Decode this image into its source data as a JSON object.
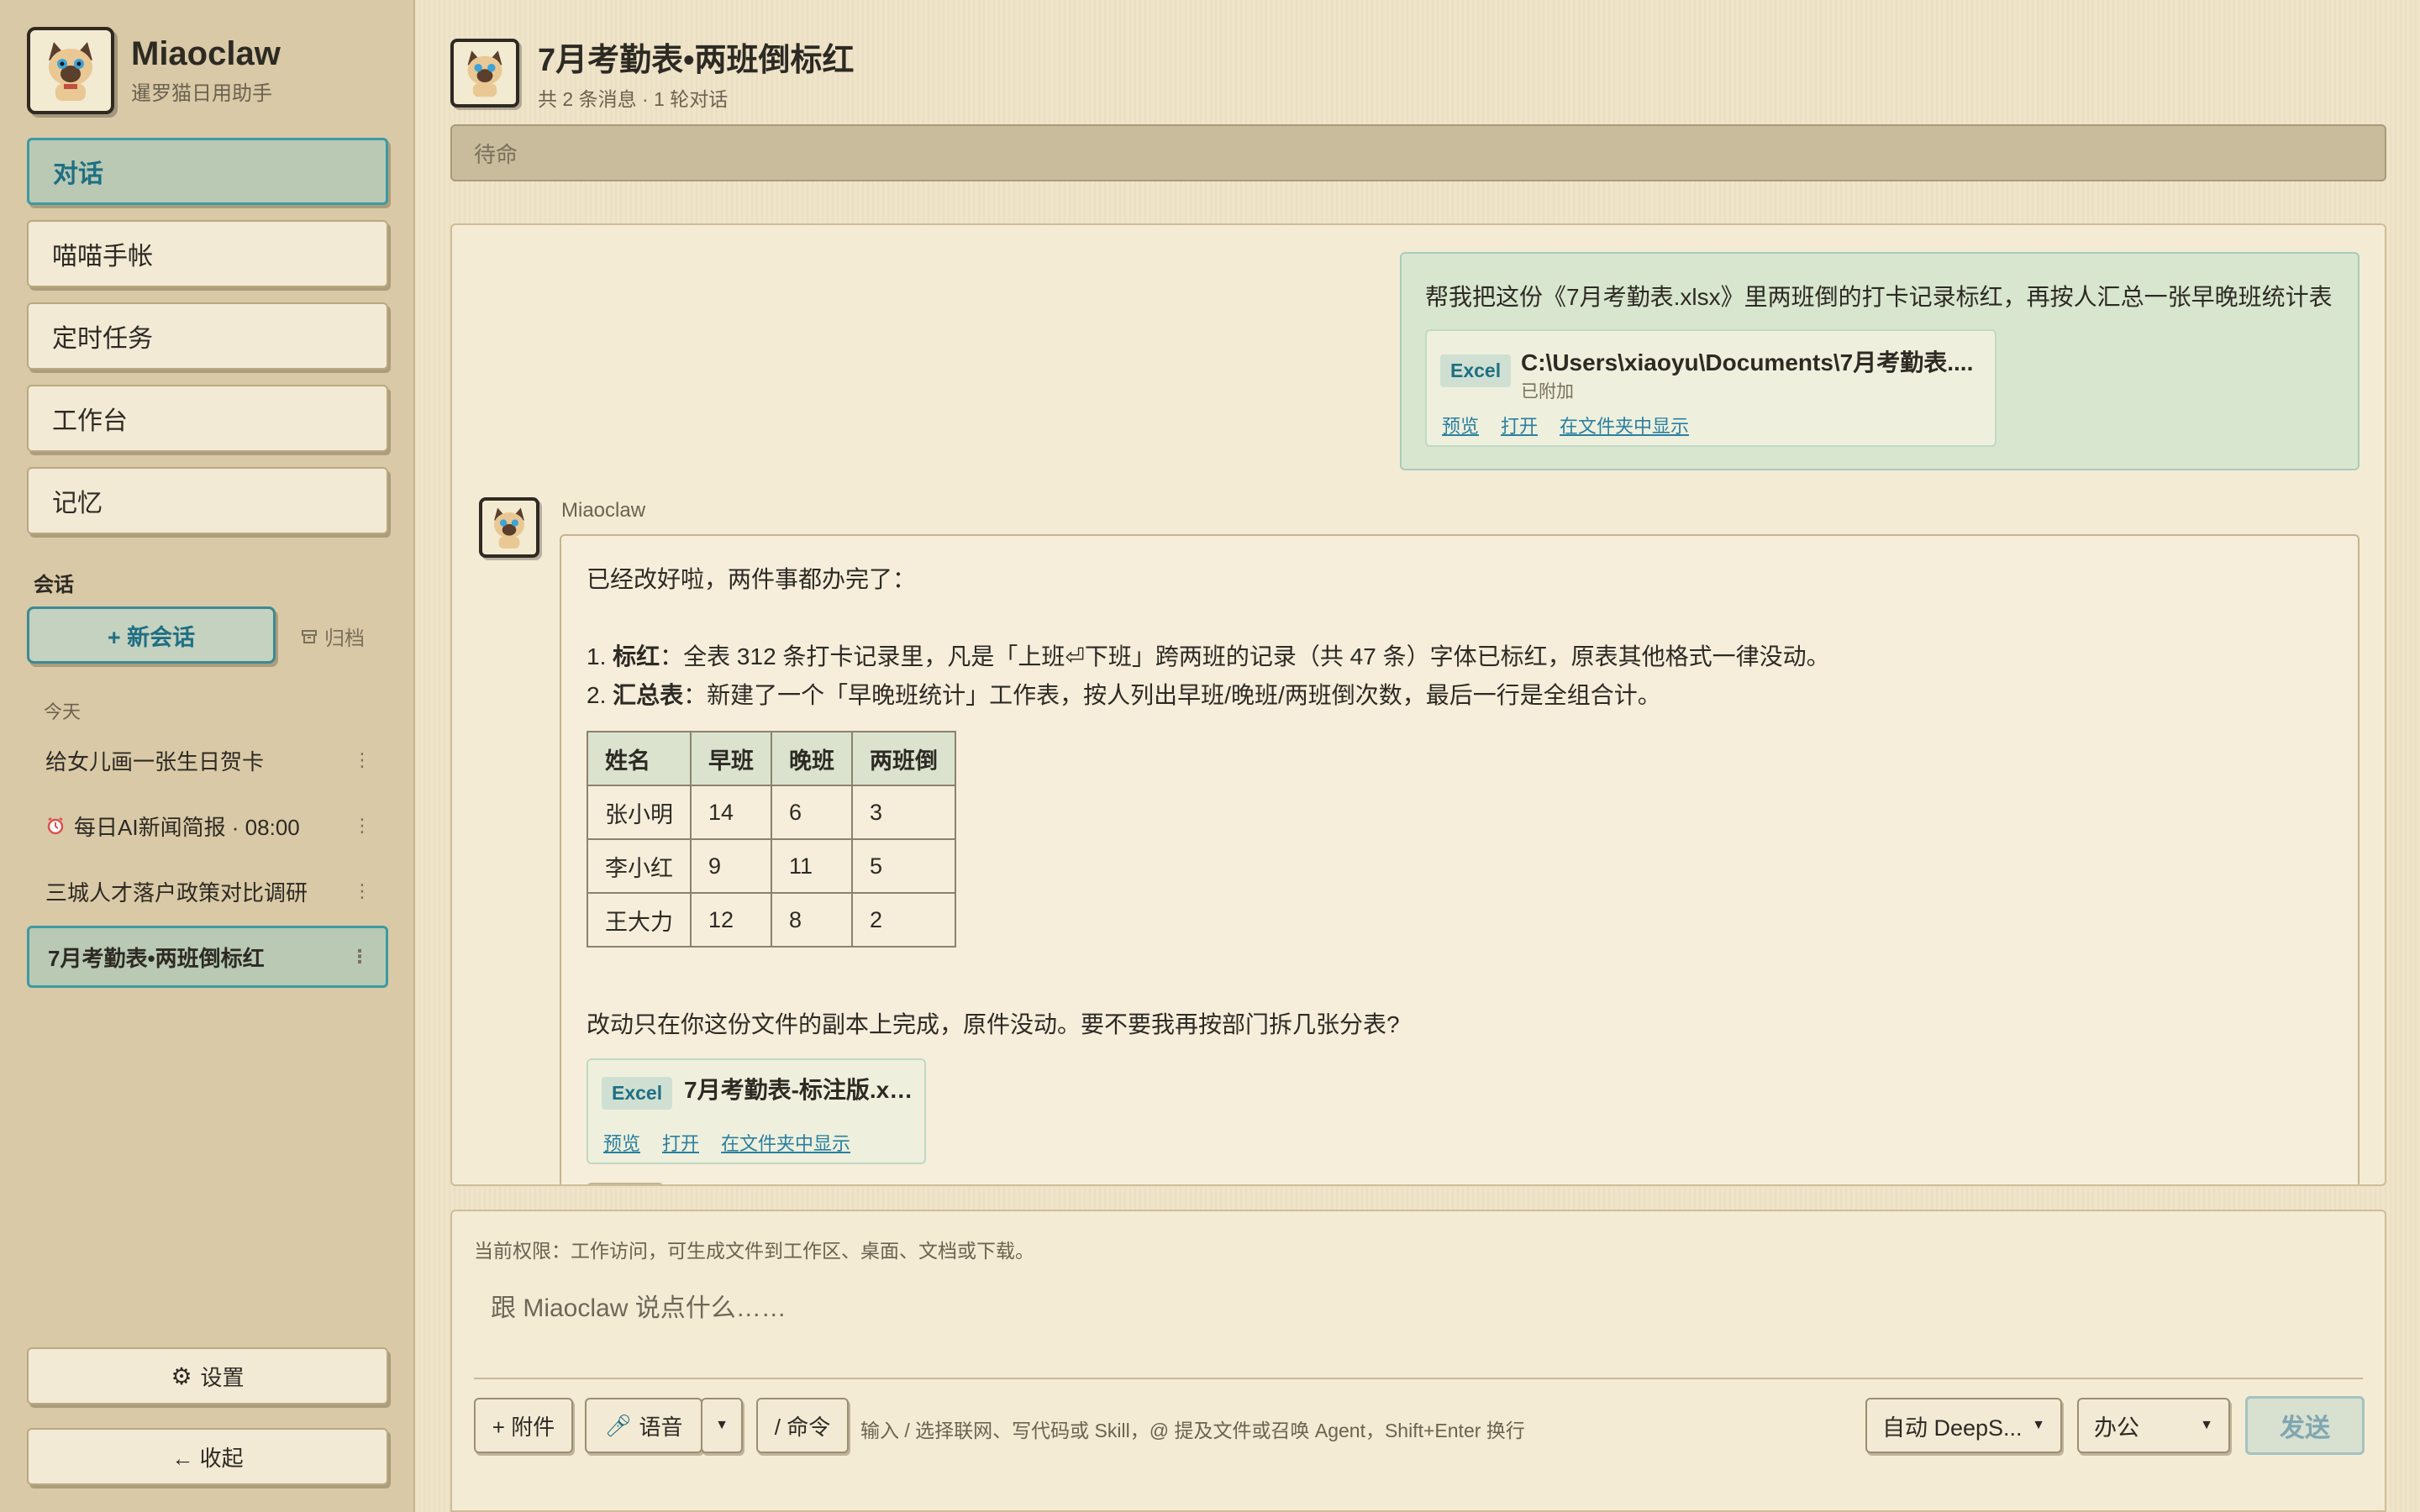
{
  "brand": {
    "title": "Miaoclaw",
    "subtitle": "暹罗猫日用助手"
  },
  "nav": [
    {
      "label": "对话",
      "active": true
    },
    {
      "label": "喵喵手帐"
    },
    {
      "label": "定时任务"
    },
    {
      "label": "工作台"
    },
    {
      "label": "记忆"
    }
  ],
  "sessions_section": {
    "label": "会话",
    "new_chat": "+ 新会话",
    "archive": "归档",
    "today": "今天",
    "items": [
      {
        "label": "给女儿画一张生日贺卡"
      },
      {
        "label": "每日AI新闻简报 · 08:00",
        "icon": "alarm-clock-icon"
      },
      {
        "label": "三城人才落户政策对比调研"
      },
      {
        "label": "7月考勤表•两班倒标红",
        "active": true
      }
    ]
  },
  "sidebar_footer": {
    "settings": "设置",
    "collapse": "← 收起"
  },
  "header": {
    "title": "7月考勤表•两班倒标红",
    "subtitle": "共 2 条消息 · 1 轮对话"
  },
  "status": "待命",
  "user_message": {
    "text": "帮我把这份《7月考勤表.xlsx》里两班倒的打卡记录标红，再按人汇总一张早晚班统计表",
    "file": {
      "badge": "Excel",
      "name": "C:\\Users\\xiaoyu\\Documents\\7月考勤表....",
      "status": "已附加",
      "links": [
        "预览",
        "打开",
        "在文件夹中显示"
      ]
    }
  },
  "bot_message": {
    "name": "Miaoclaw",
    "intro": "已经改好啦，两件事都办完了：",
    "point1_label": "标红",
    "point1_text": "：全表 312 条打卡记录里，凡是「上班⏎下班」跨两班的记录（共 47 条）字体已标红，原表其他格式一律没动。",
    "point2_label": "汇总表",
    "point2_text": "：新建了一个「早晚班统计」工作表，按人列出早班/晚班/两班倒次数，最后一行是全组合计。",
    "table": {
      "headers": [
        "姓名",
        "早班",
        "晚班",
        "两班倒"
      ],
      "rows": [
        [
          "张小明",
          "14",
          "6",
          "3"
        ],
        [
          "李小红",
          "9",
          "11",
          "5"
        ],
        [
          "王大力",
          "12",
          "8",
          "2"
        ]
      ]
    },
    "outro": "改动只在你这份文件的副本上完成，原件没动。要不要我再按部门拆几张分表?",
    "file": {
      "badge": "Excel",
      "name": "7月考勤表-标注版.xlsx",
      "links": [
        "预览",
        "打开",
        "在文件夹中显示"
      ]
    }
  },
  "composer": {
    "permission": "当前权限：工作访问，可生成文件到工作区、桌面、文档或下载。",
    "placeholder": "跟 Miaoclaw 说点什么……",
    "attach": "+ 附件",
    "voice": "语音",
    "command": "/ 命令",
    "hint": "输入 / 选择联网、写代码或 Skill，@ 提及文件或召唤 Agent，Shift+Enter 换行",
    "model": "自动 DeepS...",
    "mode": "办公",
    "send": "发送"
  }
}
